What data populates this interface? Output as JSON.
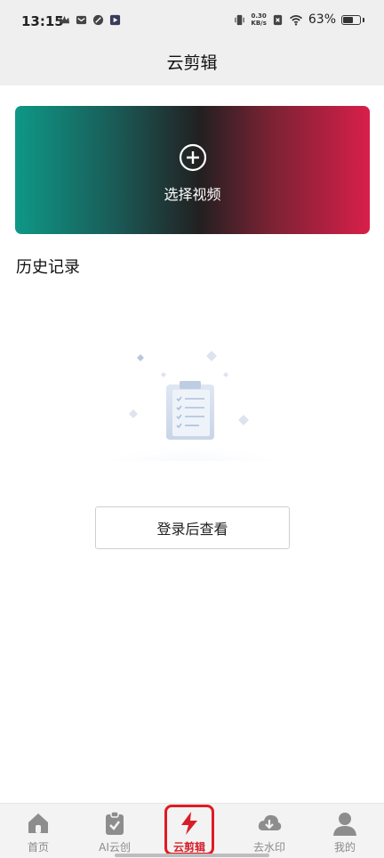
{
  "status_bar": {
    "time": "13:15",
    "net_speed_value": "0.30",
    "net_speed_unit": "KB/s",
    "battery_percent": "63%",
    "battery_level": 0.63
  },
  "header": {
    "title": "云剪辑"
  },
  "hero": {
    "label": "选择视频",
    "icon": "plus-circle-icon",
    "colors": [
      "#0e9887",
      "#222021",
      "#d81f4a"
    ]
  },
  "history": {
    "title": "历史记录",
    "login_button": "登录后查看",
    "illustration": "empty-clipboard-illustration"
  },
  "tabbar": {
    "active_index": 2,
    "accent": "#d61f2a",
    "items": [
      {
        "label": "首页",
        "icon": "home-icon"
      },
      {
        "label": "AI云创",
        "icon": "clipboard-check-icon"
      },
      {
        "label": "云剪辑",
        "icon": "lightning-icon"
      },
      {
        "label": "去水印",
        "icon": "cloud-download-icon"
      },
      {
        "label": "我的",
        "icon": "user-icon"
      }
    ]
  }
}
